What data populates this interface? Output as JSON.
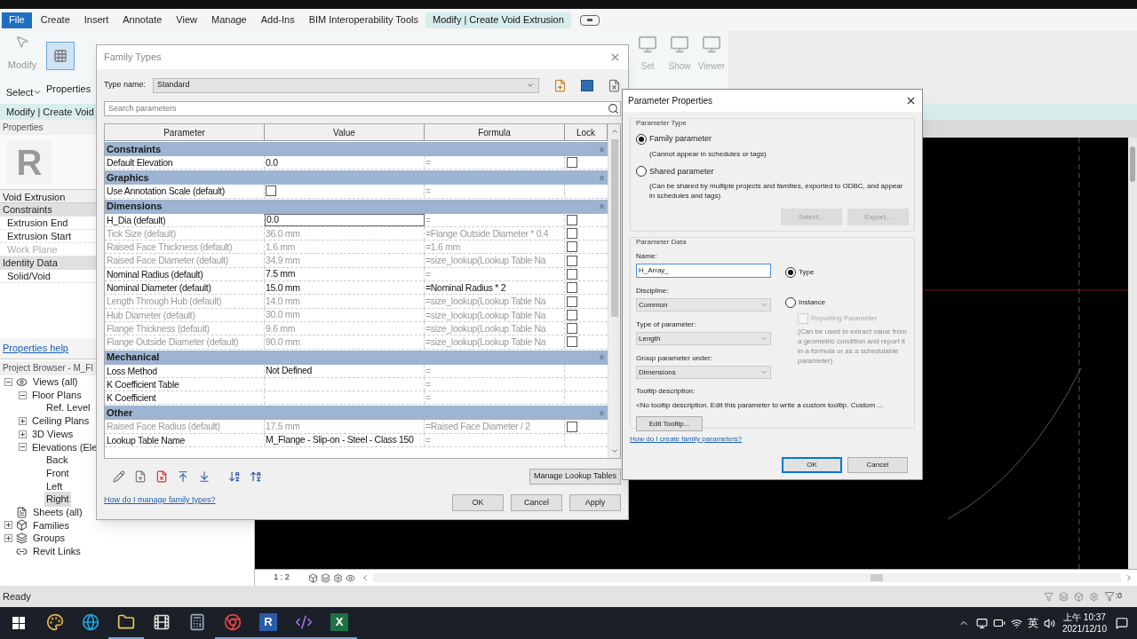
{
  "app": {
    "menu_tabs": [
      {
        "label": "File",
        "kind": "file",
        "selected": false
      },
      {
        "label": "Create",
        "kind": "tab",
        "selected": false
      },
      {
        "label": "Insert",
        "kind": "tab",
        "selected": false
      },
      {
        "label": "Annotate",
        "kind": "tab",
        "selected": false
      },
      {
        "label": "View",
        "kind": "tab",
        "selected": false
      },
      {
        "label": "Manage",
        "kind": "tab",
        "selected": false
      },
      {
        "label": "Add-Ins",
        "kind": "tab",
        "selected": false
      },
      {
        "label": "BIM Interoperability Tools",
        "kind": "tab",
        "selected": false
      },
      {
        "label": "Modify | Create Void Extrusion",
        "kind": "tab",
        "selected": true
      }
    ],
    "ribbon": {
      "modify": "Modify",
      "select": "Select",
      "properties": "Properties",
      "view_tools": [
        "Set",
        "Show",
        "Viewer"
      ]
    },
    "context_label": "Modify | Create Void"
  },
  "properties": {
    "title": "Properties",
    "preview_letter": "R",
    "type": "Void Extrusion",
    "groups": [
      {
        "name": "Constraints",
        "items": [
          {
            "label": "Extrusion End",
            "disabled": false
          },
          {
            "label": "Extrusion Start",
            "disabled": false
          },
          {
            "label": "Work Plane",
            "disabled": true
          }
        ]
      },
      {
        "name": "Identity Data",
        "items": [
          {
            "label": "Solid/Void",
            "disabled": false
          }
        ]
      }
    ],
    "help_link": "Properties help"
  },
  "project_browser": {
    "title": "Project Browser - M_Fl",
    "tree": [
      {
        "label": "Views (all)",
        "expanded": true,
        "selected": false,
        "children": [
          {
            "label": "Floor Plans",
            "expanded": true,
            "selected": false,
            "children": [
              {
                "label": "Ref. Level",
                "selected": false
              }
            ]
          },
          {
            "label": "Ceiling Plans",
            "expanded": false,
            "selected": false
          },
          {
            "label": "3D Views",
            "expanded": false,
            "selected": false
          },
          {
            "label": "Elevations (Ele",
            "expanded": true,
            "selected": false,
            "children": [
              {
                "label": "Back",
                "selected": false
              },
              {
                "label": "Front",
                "selected": false
              },
              {
                "label": "Left",
                "selected": false
              },
              {
                "label": "Right",
                "selected": true
              }
            ]
          }
        ]
      },
      {
        "label": "Sheets (all)",
        "selected": false
      },
      {
        "label": "Families",
        "expanded": false,
        "selected": false
      },
      {
        "label": "Groups",
        "expanded": false,
        "selected": false
      },
      {
        "label": "Revit Links",
        "selected": false
      }
    ]
  },
  "view": {
    "scale": "1 : 2"
  },
  "family_types": {
    "title": "Family Types",
    "type_name_label": "Type name:",
    "type_name": "Standard",
    "search_placeholder": "Search parameters",
    "columns": [
      "Parameter",
      "Value",
      "Formula",
      "Lock"
    ],
    "groups": [
      {
        "name": "Constraints",
        "rows": [
          {
            "parameter": "Default Elevation",
            "kind": "text",
            "value": "0.0",
            "formula": "=",
            "lock": false,
            "disabled": false,
            "selected": false
          }
        ]
      },
      {
        "name": "Graphics",
        "rows": [
          {
            "parameter": "Use Annotation Scale (default)",
            "kind": "checkbox",
            "checked": false,
            "formula": "=",
            "lock": null,
            "disabled": false,
            "selected": false
          }
        ]
      },
      {
        "name": "Dimensions",
        "rows": [
          {
            "parameter": "H_Dia (default)",
            "kind": "text",
            "value": "0.0",
            "formula": "=",
            "lock": false,
            "disabled": false,
            "selected": true
          },
          {
            "parameter": "Tick Size (default)",
            "kind": "text",
            "value": "36.0 mm",
            "formula": "=Flange Outside Diameter * 0.4",
            "lock": false,
            "disabled": true,
            "selected": false
          },
          {
            "parameter": "Raised Face Thickness (default)",
            "kind": "text",
            "value": "1.6 mm",
            "formula": "=1.6 mm",
            "lock": false,
            "disabled": true,
            "selected": false
          },
          {
            "parameter": "Raised Face Diameter (default)",
            "kind": "text",
            "value": "34.9 mm",
            "formula": "=size_lookup(Lookup Table Na",
            "lock": false,
            "disabled": true,
            "selected": false
          },
          {
            "parameter": "Nominal Radius (default)",
            "kind": "text",
            "value": "7.5 mm",
            "formula": "=",
            "lock": false,
            "disabled": false,
            "selected": false
          },
          {
            "parameter": "Nominal Diameter (default)",
            "kind": "text",
            "value": "15.0 mm",
            "formula": "=Nominal Radius * 2",
            "lock": false,
            "disabled": false,
            "selected": false
          },
          {
            "parameter": "Length Through Hub (default)",
            "kind": "text",
            "value": "14.0 mm",
            "formula": "=size_lookup(Lookup Table Na",
            "lock": false,
            "disabled": true,
            "selected": false
          },
          {
            "parameter": "Hub Diameter (default)",
            "kind": "text",
            "value": "30.0 mm",
            "formula": "=size_lookup(Lookup Table Na",
            "lock": false,
            "disabled": true,
            "selected": false
          },
          {
            "parameter": "Flange Thickness (default)",
            "kind": "text",
            "value": "9.6 mm",
            "formula": "=size_lookup(Lookup Table Na",
            "lock": false,
            "disabled": true,
            "selected": false
          },
          {
            "parameter": "Flange Outside Diameter (default)",
            "kind": "text",
            "value": "90.0 mm",
            "formula": "=size_lookup(Lookup Table Na",
            "lock": false,
            "disabled": true,
            "selected": false
          }
        ]
      },
      {
        "name": "Mechanical",
        "rows": [
          {
            "parameter": "Loss Method",
            "kind": "text",
            "value": "Not Defined",
            "formula": "=",
            "lock": null,
            "disabled": false,
            "selected": false
          },
          {
            "parameter": "K Coefficient Table",
            "kind": "text",
            "formula": "=",
            "lock": null,
            "disabled": false,
            "selected": false
          },
          {
            "parameter": "K Coefficient",
            "kind": "text",
            "formula": "=",
            "lock": null,
            "disabled": false,
            "selected": false
          }
        ]
      },
      {
        "name": "Other",
        "rows": [
          {
            "parameter": "Raised Face Radius (default)",
            "kind": "text",
            "value": "17.5 mm",
            "formula": "=Raised Face Diameter / 2",
            "lock": false,
            "disabled": true,
            "selected": false
          },
          {
            "parameter": "Lookup Table Name",
            "kind": "text",
            "value": "M_Flange - Slip-on - Steel - Class 150",
            "formula": "=",
            "lock": null,
            "disabled": false,
            "selected": false
          }
        ]
      }
    ],
    "manage_button": "Manage Lookup Tables",
    "help_link": "How do I manage family types?",
    "buttons": [
      "OK",
      "Cancel",
      "Apply"
    ]
  },
  "parameter_properties": {
    "title": "Parameter Properties",
    "type_group": "Parameter Type",
    "type_options": [
      {
        "label": "Family parameter",
        "note": "(Cannot appear in schedules or tags)",
        "selected": true
      },
      {
        "label": "Shared parameter",
        "note": "(Can be shared by multiple projects and families, exported to ODBC, and appear in schedules and tags)",
        "selected": false
      }
    ],
    "shared_buttons": [
      {
        "label": "Select...",
        "disabled": true
      },
      {
        "label": "Export...",
        "disabled": true
      }
    ],
    "data_group": "Parameter Data",
    "name_label": "Name:",
    "name_value": "H_Array_",
    "dropdowns": [
      {
        "label": "Discipline:",
        "value": "Common"
      },
      {
        "label": "Type of parameter:",
        "value": "Length"
      },
      {
        "label": "Group parameter under:",
        "value": "Dimensions"
      }
    ],
    "scope_options": [
      {
        "label": "Type",
        "selected": true
      },
      {
        "label": "Instance",
        "selected": false
      }
    ],
    "reporting": {
      "label": "Reporting Parameter",
      "checked": false,
      "disabled": true,
      "note": "(Can be used to extract value from a geometric condition and report it in a formula or as a schedulable parameter)"
    },
    "tooltip_label": "Tooltip description:",
    "tooltip_text": "<No tooltip description. Edit this parameter to write a custom tooltip. Custom ...",
    "edit_tooltip": "Edit Tooltip...",
    "help_link": "How do I create family parameters?",
    "buttons": [
      "OK",
      "Cancel"
    ]
  },
  "status_bar": {
    "text": "Ready",
    "filter_count": ":0"
  },
  "taskbar": {
    "apps": [
      {
        "kind": "paint",
        "active": false
      },
      {
        "kind": "edge",
        "active": false
      },
      {
        "kind": "folder",
        "active": true
      },
      {
        "kind": "media",
        "active": false
      },
      {
        "kind": "calculator",
        "active": false
      },
      {
        "kind": "chrome",
        "active": true
      },
      {
        "kind": "revit",
        "glyph": "R",
        "active": true
      },
      {
        "kind": "studio",
        "active": true
      },
      {
        "kind": "excel",
        "glyph": "X",
        "active": true
      }
    ],
    "ime": "英",
    "time": "上午 10:37",
    "date": "2021/12/10"
  }
}
